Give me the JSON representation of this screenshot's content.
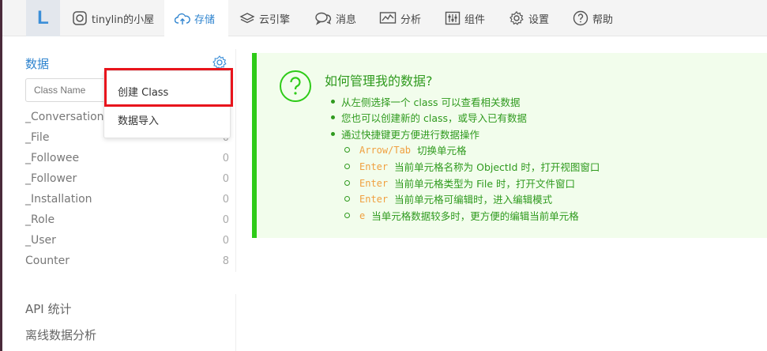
{
  "nav": {
    "logo": "L",
    "items": [
      {
        "label": "tinylin的小屋",
        "icon": "instagram-icon"
      },
      {
        "label": "存储",
        "icon": "cloud-upload-icon",
        "active": true
      },
      {
        "label": "云引擎",
        "icon": "layers-icon"
      },
      {
        "label": "消息",
        "icon": "chat-bubbles-icon"
      },
      {
        "label": "分析",
        "icon": "chart-icon"
      },
      {
        "label": "组件",
        "icon": "sliders-icon"
      },
      {
        "label": "设置",
        "icon": "gear-icon"
      },
      {
        "label": "帮助",
        "icon": "question-icon"
      }
    ]
  },
  "sidebar": {
    "title": "数据",
    "search_placeholder": "Class Name",
    "classes": [
      {
        "name": "_Conversation",
        "count": ""
      },
      {
        "name": "_File",
        "count": "0"
      },
      {
        "name": "_Followee",
        "count": "0"
      },
      {
        "name": "_Follower",
        "count": "0"
      },
      {
        "name": "_Installation",
        "count": "0"
      },
      {
        "name": "_Role",
        "count": "0"
      },
      {
        "name": "_User",
        "count": "0"
      },
      {
        "name": "Counter",
        "count": "8"
      }
    ],
    "links": [
      "API 统计",
      "离线数据分析"
    ]
  },
  "dropdown": {
    "items": [
      "创建 Class",
      "数据导入"
    ]
  },
  "help": {
    "title": "如何管理我的数据?",
    "bullets": [
      "从左侧选择一个 class 可以查看相关数据",
      "您也可以创建新的 class，或导入已有数据",
      "通过快捷键更方便进行数据操作"
    ],
    "shortcuts": [
      {
        "key": "Arrow/Tab",
        "desc": "切换单元格"
      },
      {
        "key": "Enter",
        "desc": "当前单元格名称为 ObjectId 时，打开视图窗口"
      },
      {
        "key": "Enter",
        "desc": "当前单元格类型为 File 时，打开文件窗口"
      },
      {
        "key": "Enter",
        "desc": "当前单元格可编辑时，进入编辑模式"
      },
      {
        "key": "e",
        "desc": "当单元格数据较多时，更方便的编辑当前单元格"
      }
    ]
  },
  "colors": {
    "accent": "#2f84cf",
    "help_green": "#2f9a1e",
    "highlight_red": "#e8141c"
  }
}
